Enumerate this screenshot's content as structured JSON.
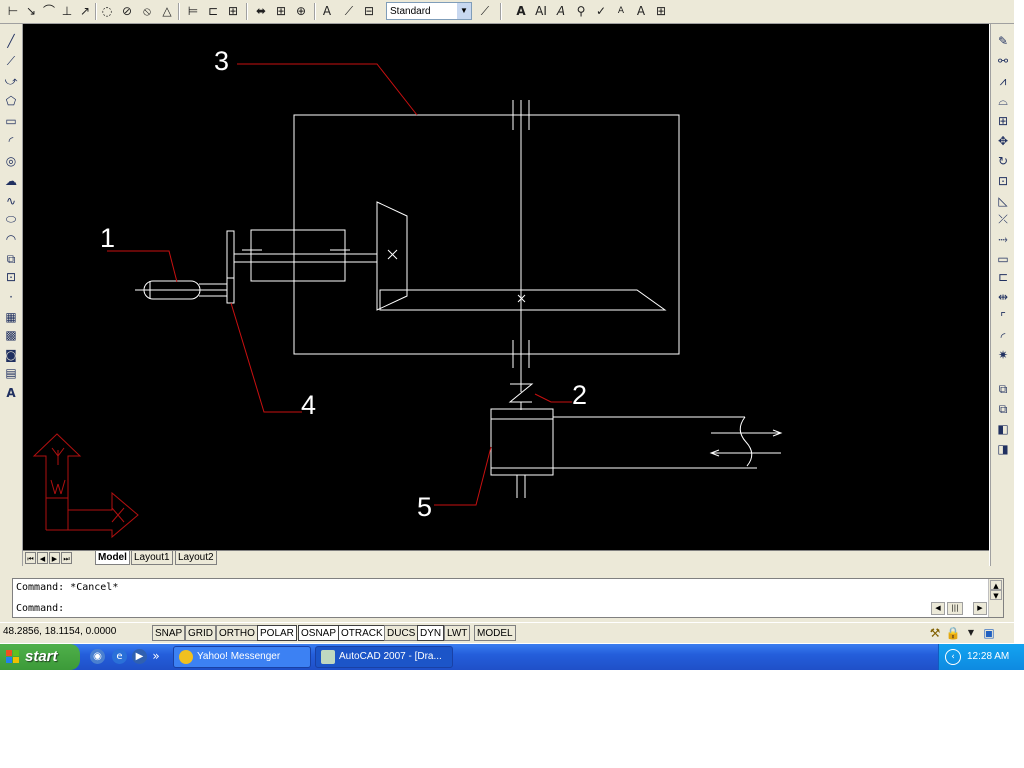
{
  "toolbar": {
    "text_style": "Standard",
    "left_icons": [
      "linear-dim-icon",
      "aligned-dim-icon",
      "arc-length-dim-icon",
      "ordinate-dim-icon",
      "radius-dim-icon",
      "jogged-dim-icon",
      "diameter-dim-icon",
      "angular-dim-icon",
      "quick-dim-icon",
      "baseline-dim-icon",
      "continue-dim-icon",
      "leader-icon",
      "tolerance-icon",
      "center-mark-icon",
      "dim-edit-icon",
      "dim-text-edit-icon",
      "dim-update-icon"
    ],
    "text_icons": [
      "multiline-text-icon",
      "single-line-text-icon",
      "edit-text-icon",
      "find-replace-icon",
      "spelling-icon",
      "text-style-icon",
      "scale-text-icon",
      "justify-text-icon",
      "convert-space-icon"
    ]
  },
  "draw_toolbar": [
    "line",
    "construction-line",
    "polyline",
    "polygon",
    "rectangle",
    "arc",
    "circle",
    "revision-cloud",
    "spline",
    "ellipse",
    "ellipse-arc",
    "insert-block",
    "make-block",
    "point",
    "hatch",
    "gradient",
    "region",
    "table",
    "multiline-text"
  ],
  "modify_toolbar": [
    "erase",
    "copy",
    "mirror",
    "offset",
    "array",
    "move",
    "rotate",
    "scale",
    "stretch",
    "trim",
    "extend",
    "break-at-point",
    "break",
    "join",
    "chamfer",
    "fillet",
    "explode",
    "draw-order-front",
    "draw-order-back",
    "bring-above",
    "send-under"
  ],
  "drawing": {
    "labels": [
      "1",
      "2",
      "3",
      "4",
      "5"
    ]
  },
  "layout_tabs": [
    "Model",
    "Layout1",
    "Layout2"
  ],
  "command": {
    "history": "Command: *Cancel*",
    "prompt": "Command:"
  },
  "status": {
    "coords": "48.2856, 18.1154, 0.0000",
    "toggles": [
      "SNAP",
      "GRID",
      "ORTHO",
      "POLAR",
      "OSNAP",
      "OTRACK",
      "DUCS",
      "DYN",
      "LWT",
      "MODEL"
    ]
  },
  "taskbar": {
    "start": "start",
    "tasks": [
      "Yahoo! Messenger",
      "AutoCAD 2007 - [Dra..."
    ],
    "clock": "12:28 AM"
  },
  "colors": {
    "canvas": "#000000",
    "line": "#ffffff",
    "leader": "#c81010",
    "ucs": "#b01010"
  }
}
